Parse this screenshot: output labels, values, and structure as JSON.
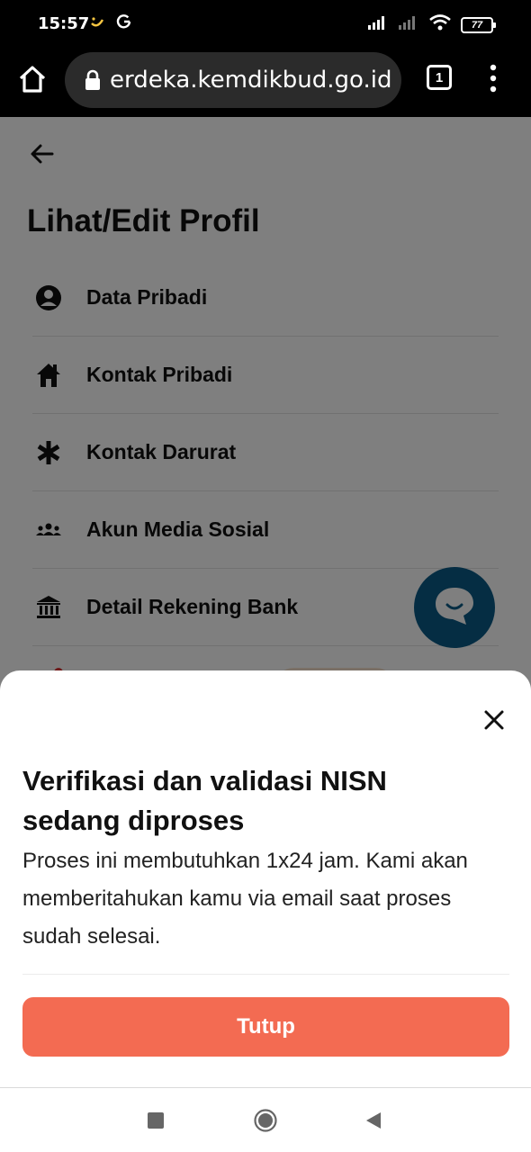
{
  "status_bar": {
    "time": "15:57",
    "battery": "77"
  },
  "browser": {
    "url": "erdeka.kemdikbud.go.id",
    "tab_count": "1"
  },
  "page": {
    "title": "Lihat/Edit Profil",
    "menu_items": [
      {
        "label": "Data Pribadi",
        "icon": "user-circle-icon"
      },
      {
        "label": "Kontak Pribadi",
        "icon": "house-icon"
      },
      {
        "label": "Kontak Darurat",
        "icon": "asterisk-icon"
      },
      {
        "label": "Akun Media Sosial",
        "icon": "people-icon"
      },
      {
        "label": "Detail Rekening Bank",
        "icon": "bank-icon"
      }
    ]
  },
  "sheet": {
    "title": "Verifikasi dan validasi NISN sedang diproses",
    "body": "Proses ini membutuhkan 1x24 jam. Kami akan memberitahukan kamu via email saat proses sudah selesai.",
    "button_label": "Tutup"
  },
  "colors": {
    "primary_button": "#f36b52",
    "chat_fab": "#0a5a86"
  }
}
